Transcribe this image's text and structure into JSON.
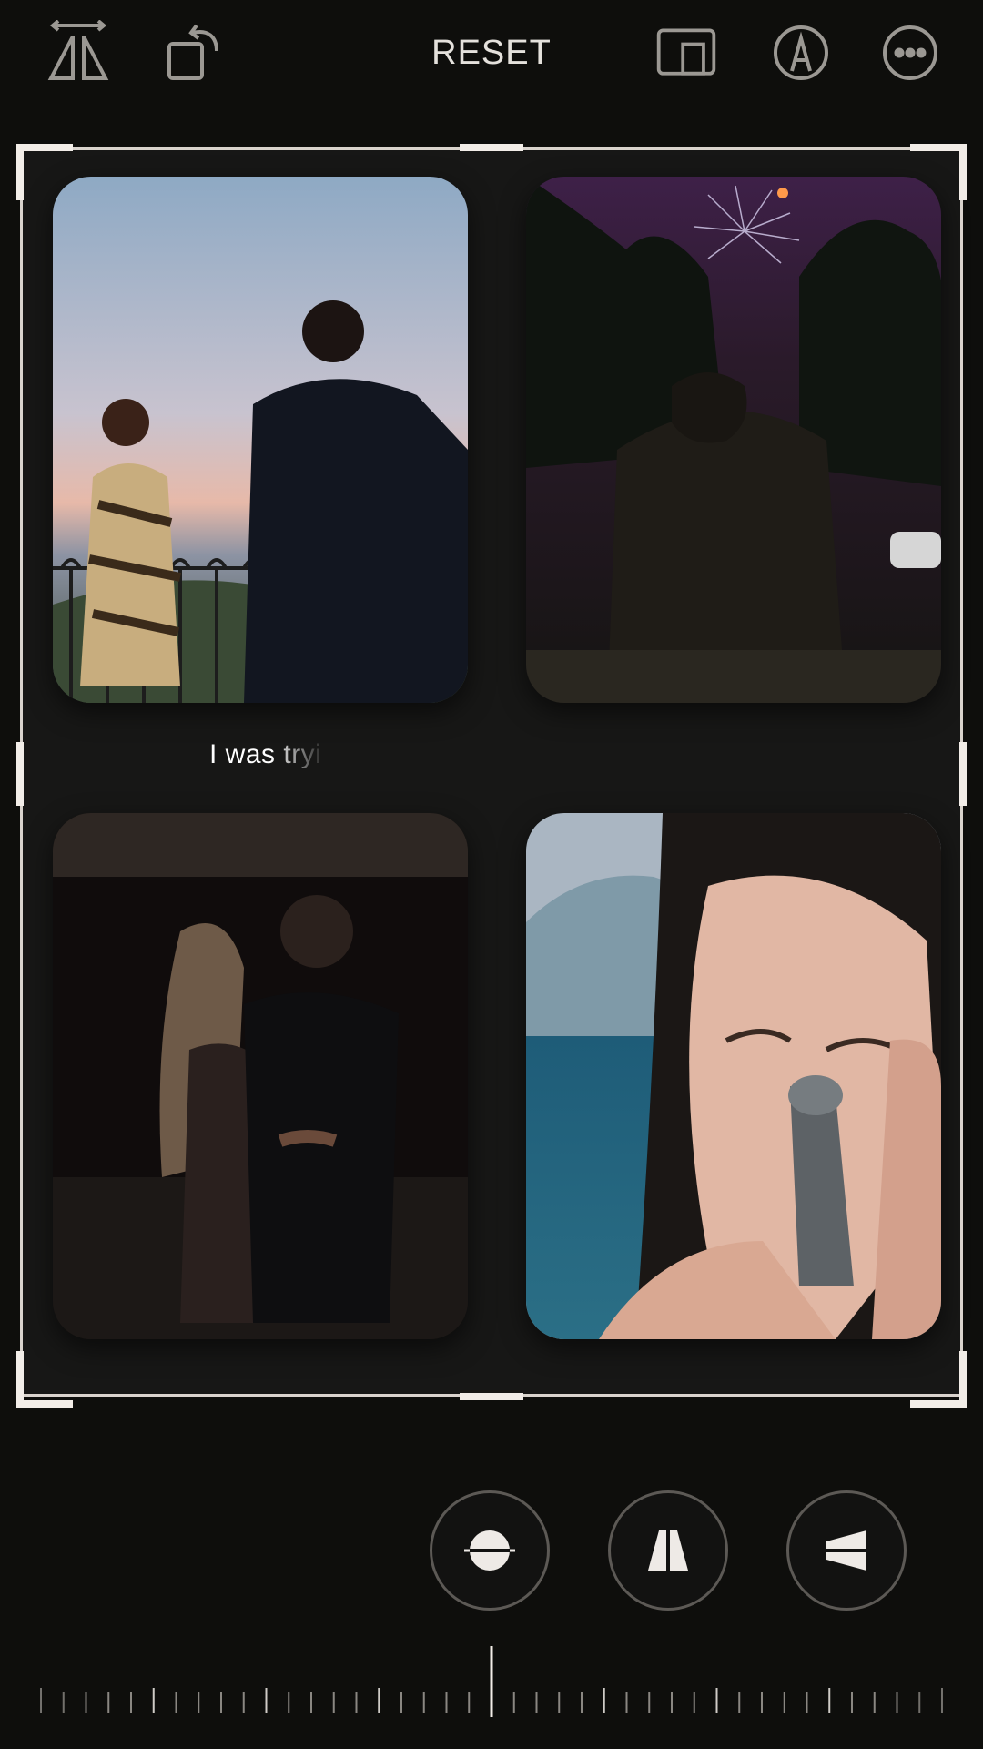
{
  "toolbar": {
    "reset_label": "RESET",
    "icons": [
      "flip-horizontal-icon",
      "rotate-icon",
      "aspect-ratio-icon",
      "markup-icon",
      "more-icon"
    ]
  },
  "collage": {
    "caption": "I was tryi",
    "photos": [
      "couple-at-sunset-balcony",
      "couple-under-fireworks",
      "couple-dancing-indoors",
      "woman-face-by-sea"
    ]
  },
  "adjustments": [
    "straighten-icon",
    "vertical-perspective-icon",
    "horizontal-perspective-icon"
  ],
  "colors": {
    "background": "#0e0e0c",
    "frame": "#f2ede8",
    "text": "#e4e1dc"
  }
}
